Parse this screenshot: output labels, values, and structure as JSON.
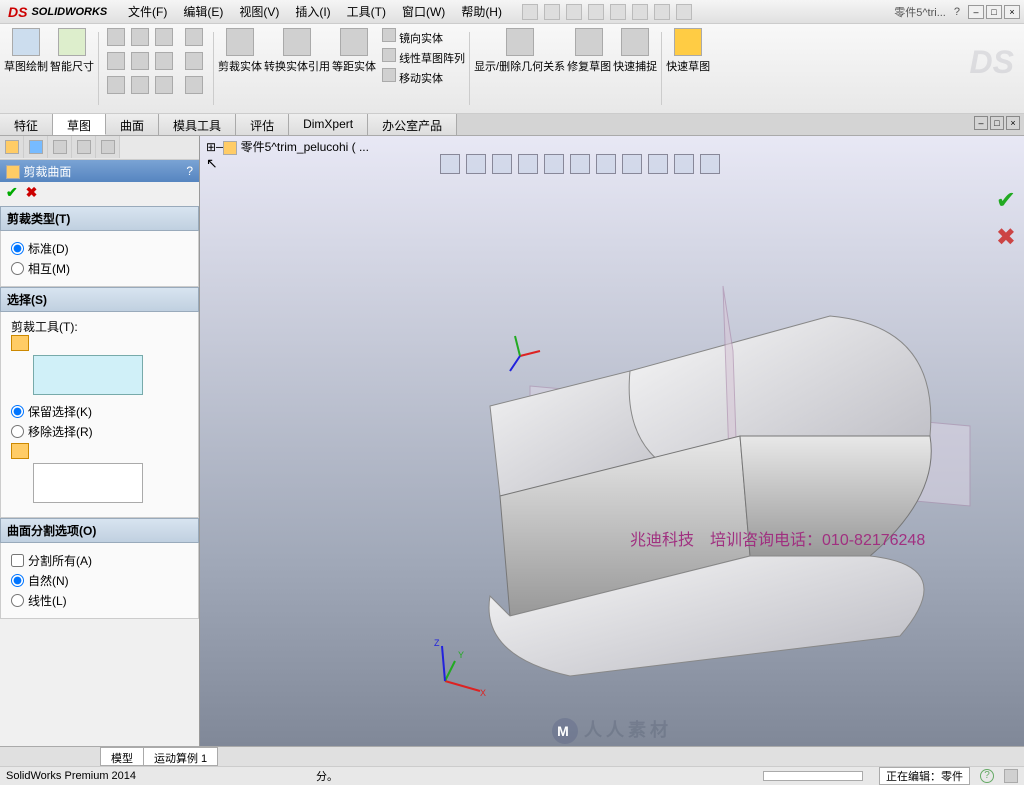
{
  "app": {
    "brand": "SOLIDWORKS",
    "document": "零件5^tri...",
    "help_q": "?"
  },
  "menu": {
    "file": "文件(F)",
    "edit": "编辑(E)",
    "view": "视图(V)",
    "insert": "插入(I)",
    "tools": "工具(T)",
    "window": "窗口(W)",
    "help": "帮助(H)"
  },
  "ribbon": {
    "sketch_draw": "草图绘制",
    "smart_dim": "智能尺寸",
    "trim_ent": "剪裁实体",
    "convert_ent": "转换实体引用",
    "offset_ent": "等距实体",
    "mirror": "镜向实体",
    "pattern": "线性草图阵列",
    "move": "移动实体",
    "show_rel": "显示/删除几何关系",
    "repair": "修复草图",
    "quick_snap": "快速捕捉",
    "rapid_sk": "快速草图"
  },
  "tabs": {
    "t0": "特征",
    "t1": "草图",
    "t2": "曲面",
    "t3": "模具工具",
    "t4": "评估",
    "t5": "DimXpert",
    "t6": "办公室产品"
  },
  "panel": {
    "title": "剪裁曲面",
    "trimtype_head": "剪裁类型(T)",
    "standard": "标准(D)",
    "mutual": "相互(M)",
    "select_head": "选择(S)",
    "trim_tool": "剪裁工具(T):",
    "keep": "保留选择(K)",
    "remove": "移除选择(R)",
    "split_head": "曲面分割选项(O)",
    "split_all": "分割所有(A)",
    "natural": "自然(N)",
    "linear": "线性(L)"
  },
  "crumb": {
    "part": "零件5^trim_pelucohi  ( ..."
  },
  "overlay": {
    "company": "兆迪科技",
    "training": "培训咨询电话：010-82176248"
  },
  "watermark": {
    "text": "人人素材",
    "m": "M"
  },
  "bottom_tabs": {
    "model": "模型",
    "motion": "运动算例 1"
  },
  "status": {
    "product": "SolidWorks Premium 2014",
    "hint": "分。",
    "editing": "正在编辑：零件"
  },
  "triad": {
    "x": "X",
    "y": "Y",
    "z": "Z"
  }
}
